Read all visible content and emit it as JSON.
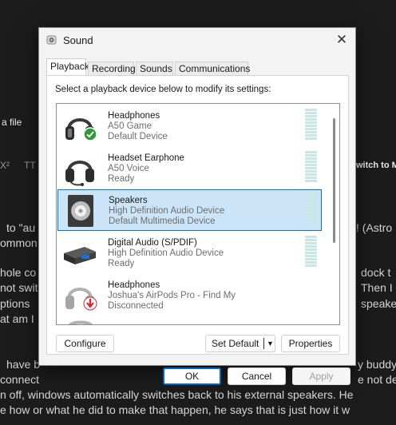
{
  "background": {
    "fragments": [
      "a file",
      "X²",
      "TT",
      "witch to M",
      "to \"au",
      "! (Astro",
      "ommon",
      "hole co",
      "dock t",
      "not swit",
      "Then I",
      "ptions",
      "speake",
      "at am I",
      "have b",
      "y buddy",
      "connect",
      "e not de",
      "n off, windows automatically switches back to his external speakers. He",
      "e how or what he did to make that happen, he says that is just how it w"
    ]
  },
  "dialog": {
    "title": "Sound",
    "close_glyph": "✕",
    "tabs": [
      "Playback",
      "Recording",
      "Sounds",
      "Communications"
    ],
    "active_tab": "Playback",
    "instruction": "Select a playback device below to modify its settings:",
    "devices": [
      {
        "name": "Headphones",
        "sub": "A50 Game",
        "status": "Default Device",
        "icon": "headphones-icon",
        "badge": "default-check",
        "selected": false
      },
      {
        "name": "Headset Earphone",
        "sub": "A50 Voice",
        "status": "Ready",
        "icon": "headset-icon",
        "badge": "",
        "selected": false
      },
      {
        "name": "Speakers",
        "sub": "High Definition Audio Device",
        "status": "Default Multimedia Device",
        "icon": "speaker-icon",
        "badge": "",
        "selected": true
      },
      {
        "name": "Digital Audio (S/PDIF)",
        "sub": "High Definition Audio Device",
        "status": "Ready",
        "icon": "digital-audio-icon",
        "badge": "",
        "selected": false
      },
      {
        "name": "Headphones",
        "sub": "Joshua's AirPods Pro - Find My",
        "status": "Disconnected",
        "icon": "headphones-icon",
        "badge": "disconnected-arrow",
        "selected": false
      }
    ],
    "buttons": {
      "configure": "Configure",
      "set_default": "Set Default",
      "properties": "Properties",
      "ok": "OK",
      "cancel": "Cancel",
      "apply": "Apply"
    },
    "colors": {
      "selection_bg": "#cce4f7",
      "selection_border": "#0078d7",
      "meter": "#c9e6e6",
      "default_badge": "#2e9a3b",
      "disconnected_badge": "#d8262d"
    }
  }
}
